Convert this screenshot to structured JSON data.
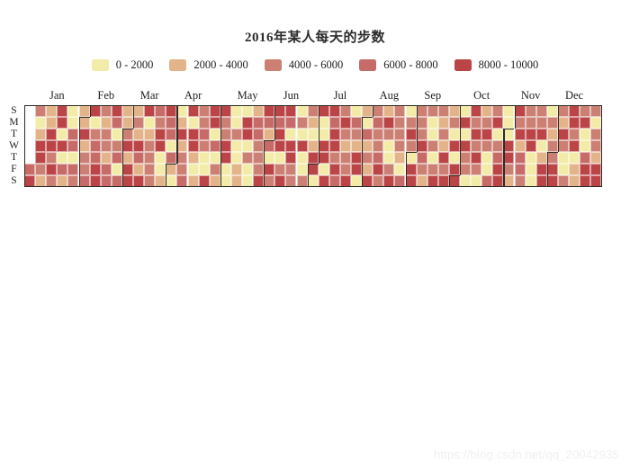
{
  "chart_data": {
    "type": "heatmap",
    "title": "2016年某人每天的步数",
    "subtitle": "",
    "xlabel": "",
    "ylabel": "",
    "grid": false,
    "legend_position": "top",
    "year": 2016,
    "value_unit": "steps",
    "first_day_weekday": 5,
    "x_tick_labels": [
      "Jan",
      "Feb",
      "Mar",
      "Apr",
      "May",
      "Jun",
      "Jul",
      "Aug",
      "Sep",
      "Oct",
      "Nov",
      "Dec"
    ],
    "y_tick_labels": [
      "S",
      "M",
      "T",
      "W",
      "T",
      "F",
      "S"
    ],
    "bins": [
      {
        "label": "0 - 2000",
        "min": 0,
        "max": 2000,
        "color": "#F2ECA8"
      },
      {
        "label": "2000 - 4000",
        "min": 2000,
        "max": 4000,
        "color": "#E3B489"
      },
      {
        "label": "4000 - 6000",
        "min": 4000,
        "max": 6000,
        "color": "#CC8074"
      },
      {
        "label": "6000 - 8000",
        "min": 6000,
        "max": 8000,
        "color": "#C66B68"
      },
      {
        "label": "8000 - 10000",
        "min": 8000,
        "max": 10000,
        "color": "#BB4447"
      }
    ],
    "month_start_week": [
      0,
      5,
      9,
      13,
      18,
      22,
      27,
      31,
      36,
      40,
      44,
      49
    ],
    "month_lengths": [
      31,
      29,
      31,
      30,
      31,
      30,
      31,
      31,
      30,
      31,
      30,
      31
    ],
    "bin_index_by_day": [
      3,
      4,
      2,
      0,
      1,
      4,
      4,
      2,
      1,
      1,
      1,
      4,
      4,
      2,
      4,
      2,
      4,
      4,
      0,
      4,
      0,
      3,
      1,
      0,
      0,
      3,
      3,
      0,
      3,
      2,
      1,
      1,
      4,
      1,
      2,
      2,
      3,
      4,
      0,
      2,
      3,
      3,
      4,
      4,
      2,
      1,
      2,
      2,
      1,
      3,
      3,
      4,
      3,
      0,
      2,
      3,
      0,
      3,
      1,
      1,
      2,
      4,
      1,
      4,
      4,
      1,
      2,
      1,
      4,
      3,
      1,
      4,
      4,
      0,
      1,
      2,
      2,
      2,
      2,
      3,
      2,
      4,
      4,
      0,
      0,
      1,
      4,
      3,
      3,
      0,
      3,
      1,
      0,
      0,
      1,
      4,
      1,
      2,
      2,
      3,
      4,
      0,
      4,
      4,
      1,
      0,
      1,
      2,
      2,
      3,
      2,
      0,
      0,
      4,
      4,
      4,
      0,
      3,
      0,
      2,
      1,
      4,
      2,
      2,
      4,
      4,
      0,
      0,
      0,
      0,
      2,
      0,
      0,
      1,
      1,
      0,
      4,
      4,
      0,
      2,
      0,
      0,
      1,
      3,
      3,
      2,
      2,
      2,
      4,
      4,
      3,
      1,
      3,
      0,
      4,
      2,
      4,
      3,
      4,
      4,
      0,
      2,
      4,
      4,
      3,
      0,
      4,
      4,
      2,
      2,
      0,
      2,
      0,
      4,
      0,
      0,
      2,
      2,
      1,
      0,
      1,
      4,
      4,
      0,
      4,
      0,
      0,
      4,
      4,
      0,
      4,
      4,
      3,
      4,
      4,
      2,
      4,
      3,
      2,
      4,
      2,
      1,
      2,
      2,
      4,
      0,
      3,
      2,
      1,
      4,
      4,
      0,
      1,
      0,
      3,
      1,
      2,
      1,
      4,
      2,
      3,
      2,
      2,
      3,
      4,
      2,
      1,
      4,
      2,
      0,
      0,
      2,
      4,
      2,
      2,
      2,
      2,
      1,
      0,
      3,
      0,
      2,
      4,
      2,
      0,
      4,
      4,
      2,
      2,
      2,
      4,
      3,
      2,
      1,
      2,
      0,
      0,
      2,
      0,
      2,
      4,
      2,
      1,
      2,
      1,
      4,
      2,
      4,
      1,
      2,
      0,
      4,
      0,
      4,
      4,
      0,
      4,
      0,
      4,
      2,
      2,
      0,
      4,
      2,
      4,
      2,
      4,
      2,
      0,
      1,
      2,
      4,
      2,
      0,
      0,
      3,
      2,
      4,
      0,
      2,
      3,
      4,
      4,
      0,
      0,
      0,
      4,
      4,
      2,
      1,
      4,
      2,
      4,
      1,
      3,
      3,
      2,
      2,
      2,
      4,
      4,
      0,
      0,
      0,
      2,
      2,
      4,
      0,
      1,
      4,
      4,
      0,
      2,
      1,
      2,
      2,
      4,
      4,
      2,
      1,
      4,
      2,
      0,
      0,
      2,
      4,
      4,
      2,
      4,
      0,
      1,
      1,
      2,
      4,
      0,
      0,
      3,
      4,
      4,
      2,
      0,
      2,
      2,
      1,
      4,
      4,
      3
    ]
  },
  "watermark": {
    "text": "https://blog.csdn.net/qq_20042935"
  }
}
